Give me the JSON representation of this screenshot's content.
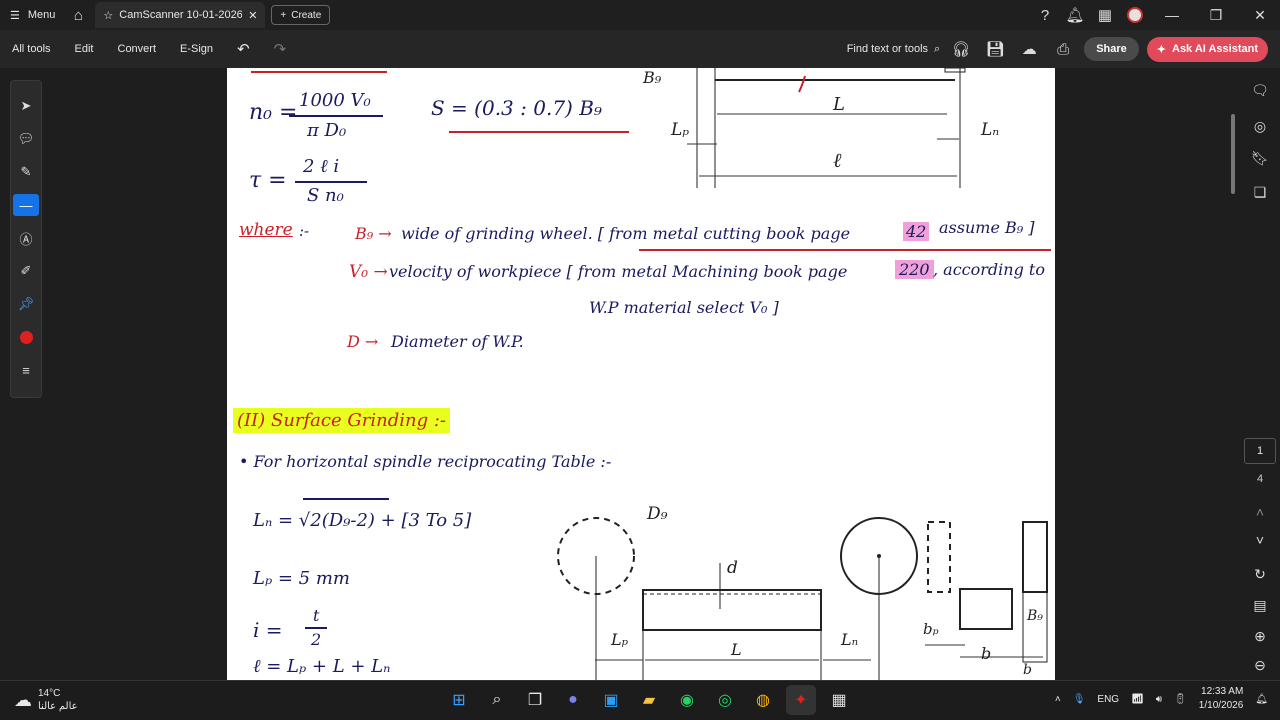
{
  "titlebar": {
    "menu_label": "Menu",
    "tab_title": "CamScanner 10-01-2026 ...",
    "create_label": "Create"
  },
  "toolbar": {
    "all_tools": "All tools",
    "edit": "Edit",
    "convert": "Convert",
    "esign": "E-Sign",
    "find_label": "Find text or tools",
    "share_label": "Share",
    "ai_label": "Ask AI Assistant"
  },
  "page_nav": {
    "current": "1",
    "total": "4"
  },
  "document": {
    "eq_n0_lhs": "n₀ =",
    "eq_n0_num": "1000 V₀",
    "eq_n0_den": "π D₀",
    "eq_S": "S = (0.3 : 0.7) B₉",
    "eq_tau_lhs": "τ =",
    "eq_tau_num": "2 ℓ i",
    "eq_tau_den": "S n₀",
    "where": "where",
    "where_suffix": ":-",
    "def_bg_sym": "B₉ →",
    "def_bg_text": "wide of grinding wheel. [ from metal cutting book page",
    "def_bg_page": "42",
    "def_bg_tail": "assume B₉ ]",
    "def_v0_sym": "V₀ →",
    "def_v0_text": "velocity of workpiece [ from metal Machining book page",
    "def_v0_page": "220",
    "def_v0_tail": ", according to",
    "def_v0_line2": "W.P material select V₀ ]",
    "def_d_sym": "D →",
    "def_d_text": "Diameter of W.P.",
    "section_title": "(II) Surface Grinding :-",
    "section_sub": "• For horizontal spindle reciprocating Table :-",
    "eq_ln": "Lₙ = √2(D₉-2)  + [3 To 5]",
    "eq_lp": "Lₚ = 5 mm",
    "eq_i_lhs": "i =",
    "eq_i_num": "t",
    "eq_i_den": "2",
    "eq_l": "ℓ = Lₚ + L + Lₙ",
    "top_fig_bg": "B₉",
    "top_fig_L": "L",
    "top_fig_lp": "Lₚ",
    "top_fig_ln": "Lₙ",
    "top_fig_l": "ℓ",
    "bot_fig_dg": "D₉",
    "bot_fig_d": "d",
    "bot_fig_lp": "Lₚ",
    "bot_fig_L": "L",
    "bot_fig_ln": "Lₙ",
    "bot_fig_bp": "bₚ",
    "bot_fig_b": "b",
    "bot_fig_bg": "B₉",
    "bot_fig_b2": "b"
  },
  "taskbar": {
    "temp": "14°C",
    "weather_text": "عالم عالنا",
    "lang": "ENG",
    "time": "12:33 AM",
    "date": "1/10/2026"
  },
  "colors": {
    "ink": "#1a1a60",
    "red": "#c8202a",
    "pink": "#f0a0d8",
    "yellow": "#e8ff20",
    "accent": "#1473e6"
  }
}
